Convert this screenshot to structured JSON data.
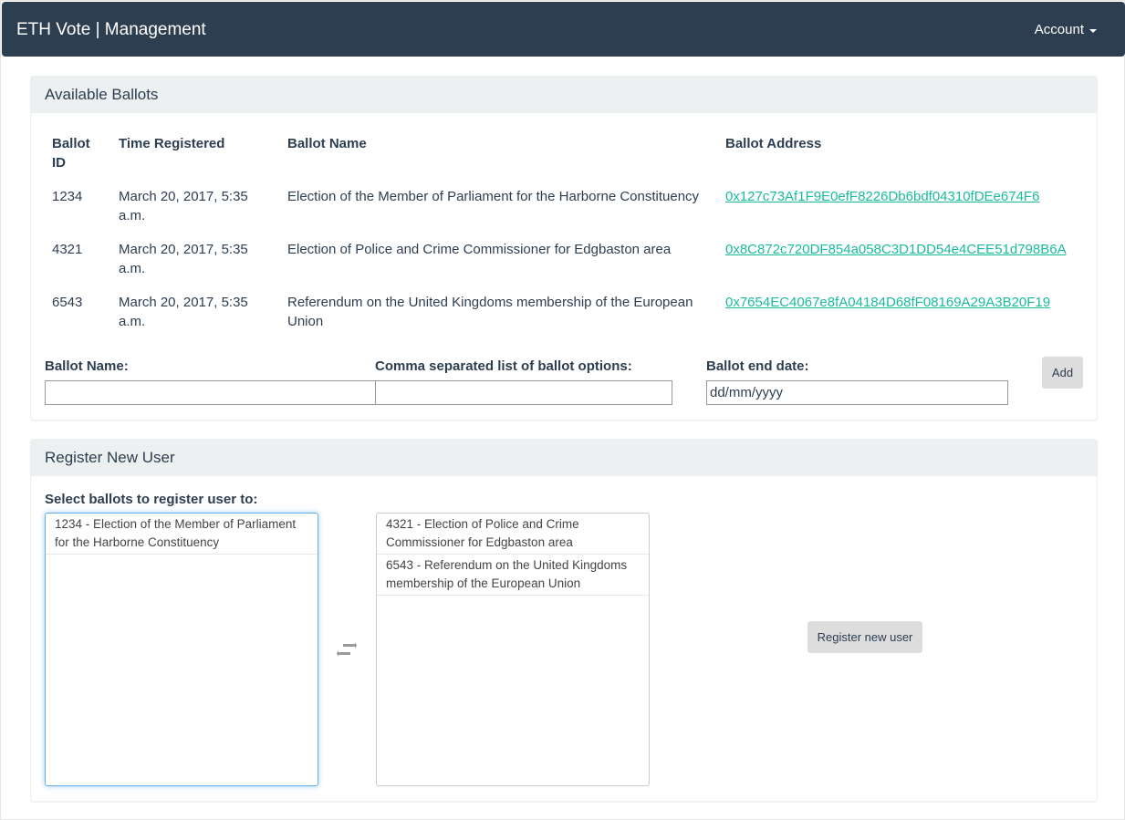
{
  "navbar": {
    "brand": "ETH Vote | Management",
    "account_label": "Account"
  },
  "ballots_panel": {
    "title": "Available Ballots",
    "columns": [
      "Ballot ID",
      "Time Registered",
      "Ballot Name",
      "Ballot Address"
    ],
    "rows": [
      {
        "id": "1234",
        "time": "March 20, 2017, 5:35 a.m.",
        "name": "Election of the Member of Parliament for the Harborne Constituency",
        "address": "0x127c73Af1F9E0efF8226Db6bdf04310fDEe674F6"
      },
      {
        "id": "4321",
        "time": "March 20, 2017, 5:35 a.m.",
        "name": "Election of Police and Crime Commissioner for Edgbaston area",
        "address": "0x8C872c720DF854a058C3D1DD54e4CEE51d798B6A"
      },
      {
        "id": "6543",
        "time": "March 20, 2017, 5:35 a.m.",
        "name": "Referendum on the United Kingdoms membership of the European Union",
        "address": "0x7654EC4067e8fA04184D68fF08169A29A3B20F19"
      }
    ],
    "form": {
      "ballot_name_label": "Ballot Name:",
      "ballot_name_value": "",
      "options_label": "Comma separated list of ballot options:",
      "options_value": "",
      "end_date_label": "Ballot end date:",
      "end_date_placeholder": "dd/mm/yyyy",
      "add_label": "Add"
    }
  },
  "register_panel": {
    "title": "Register New User",
    "select_label": "Select ballots to register user to:",
    "available": [
      "1234 - Election of the Member of Parliament for the Harborne Constituency"
    ],
    "selected": [
      "4321 - Election of Police and Crime Commissioner for Edgbaston area",
      "6543 - Referendum on the United Kingdoms membership of the European Union"
    ],
    "swap_icon": "exchange-arrows-icon",
    "register_label": "Register new user"
  },
  "colors": {
    "navbar": "#2c3e50",
    "panel_heading": "#ecf0f1",
    "link": "#18bc9c",
    "button": "#dddddd",
    "focus": "#66afe9"
  }
}
